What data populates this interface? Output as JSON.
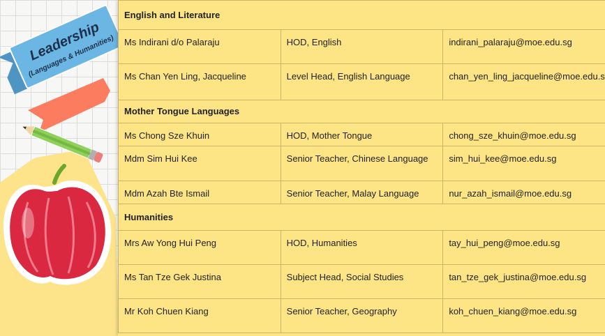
{
  "banner": {
    "title": "Leadership",
    "subtitle": "(Languages & Humanities)"
  },
  "colors": {
    "table_bg": "#fde484",
    "banner_blue": "#6cb6e3",
    "ribbon_coral": "#fb7c5e",
    "apple_red": "#d9283f",
    "sticky_yellow": "#fde38a"
  },
  "icons": [
    "pencil-icon",
    "apple-icon"
  ],
  "sections": [
    {
      "title": "English and Literature",
      "rows": [
        {
          "name": "Ms Indirani d/o Palaraju",
          "role": "HOD, English",
          "email": "indirani_palaraju@moe.edu.sg"
        },
        {
          "name": "Ms Chan Yen Ling, Jacqueline",
          "role": "Level Head, English Language",
          "email": "chan_yen_ling_jacqueline@moe.edu.sg"
        }
      ]
    },
    {
      "title": "Mother Tongue Languages",
      "rows": [
        {
          "name": "Ms Chong Sze Khuin",
          "role": "HOD, Mother Tongue",
          "email": "chong_sze_khuin@moe.edu.sg"
        },
        {
          "name": "Mdm Sim Hui Kee",
          "role": "Senior Teacher, Chinese Language",
          "email": "sim_hui_kee@moe.edu.sg"
        },
        {
          "name": "Mdm Azah Bte Ismail",
          "role": "Senior Teacher, Malay Language",
          "email": "nur_azah_ismail@moe.edu.sg"
        }
      ]
    },
    {
      "title": "Humanities",
      "rows": [
        {
          "name": "Mrs Aw Yong Hui Peng",
          "role": "HOD, Humanities",
          "email": "tay_hui_peng@moe.edu.sg"
        },
        {
          "name": "Ms Tan Tze Gek Justina",
          "role": "Subject Head, Social Studies",
          "email": "tan_tze_gek_justina@moe.edu.sg"
        },
        {
          "name": "Mr Koh Chuen Kiang",
          "role": "Senior Teacher, Geography",
          "email": "koh_chuen_kiang@moe.edu.sg"
        }
      ]
    }
  ]
}
